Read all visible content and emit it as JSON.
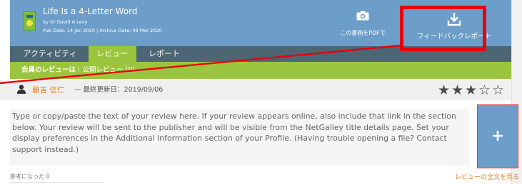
{
  "book": {
    "title": "Life Is a 4-Letter Word",
    "author": "by Dr David A Levy",
    "dates": "Pub Date: 14 Jan 2020  |  Archive Date: 09 Mar 2020"
  },
  "header": {
    "pdf_label": "この書画をPDFで",
    "feedback_label": "フィードバックレポート"
  },
  "tabs": [
    {
      "label": "アクティビティ",
      "active": false
    },
    {
      "label": "レビュー",
      "active": true
    },
    {
      "label": "レポート",
      "active": false
    }
  ],
  "subbar": {
    "my_reviews": "会員のレビューは",
    "public_reviews": "｜公開レビュー (0)"
  },
  "review": {
    "reviewer": "藤吉 信仁",
    "updated": "— 最終更新日：2019/09/06",
    "rating": 3,
    "max_rating": 5,
    "placeholder_text": "Type or copy/paste the text of your review here. If your review appears online, also include that link in the section below. Your review will be sent to the publisher and will be visible from the NetGalley title details page. Set your display preferences in the Additional Information section of your Profile. (Having trouble opening a file? Contact support instead.)",
    "add_button": "+",
    "helpful": "参考になった 0",
    "see_full": "レビューの全文を見る"
  },
  "colors": {
    "header_blue": "#6d9ec9",
    "tab_dark": "#4c6673",
    "accent_green": "#9cc53f",
    "accent_orange": "#e5802c",
    "annotation_red": "#e8000b"
  },
  "icons": {
    "pdf": "camera-icon",
    "feedback": "download-icon",
    "reviewer": "person-icon"
  }
}
